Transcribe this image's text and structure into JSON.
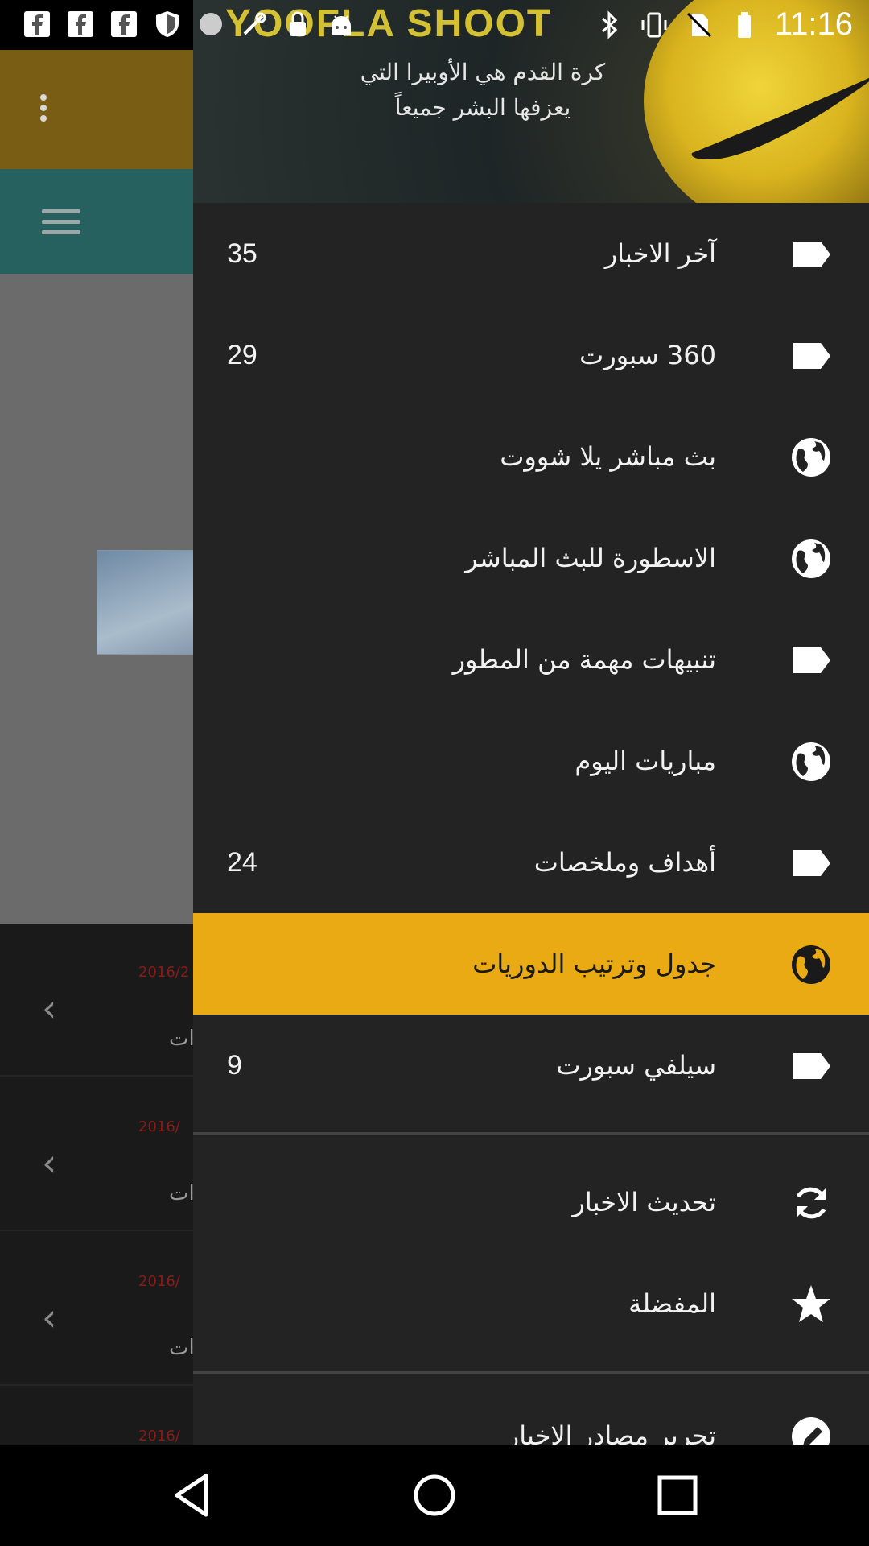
{
  "status_bar": {
    "time": "11:16",
    "left_icons": [
      "facebook-icon",
      "facebook-icon",
      "facebook-icon",
      "shield-icon",
      "circle-icon",
      "fake-gps-icon",
      "lock-icon",
      "android-icon"
    ],
    "right_icons": [
      "bluetooth-icon",
      "vibrate-icon",
      "no-sim-icon",
      "battery-icon"
    ]
  },
  "drawer": {
    "header": {
      "brand_text": "YOOFLA SHOOT",
      "quote_line_1": "كرة القدم هي الأوبيرا التي",
      "quote_line_2": "يعزفها البشر جميعاً"
    },
    "items": [
      {
        "label": "آخر الاخبار",
        "count": "35",
        "icon": "label-icon",
        "selected": false
      },
      {
        "label": "360 سبورت",
        "count": "29",
        "icon": "label-icon",
        "selected": false
      },
      {
        "label": "بث مباشر يلا شووت",
        "count": "",
        "icon": "globe-icon",
        "selected": false
      },
      {
        "label": "الاسطورة للبث المباشر",
        "count": "",
        "icon": "globe-icon",
        "selected": false
      },
      {
        "label": "تنبيهات مهمة من المطور",
        "count": "",
        "icon": "label-icon",
        "selected": false
      },
      {
        "label": "مباريات اليوم",
        "count": "",
        "icon": "globe-icon",
        "selected": false
      },
      {
        "label": "أهداف وملخصات",
        "count": "24",
        "icon": "label-icon",
        "selected": false
      },
      {
        "label": "جدول وترتيب الدوريات",
        "count": "",
        "icon": "globe-icon",
        "selected": true
      },
      {
        "label": "سيلفي سبورت",
        "count": "9",
        "icon": "label-icon",
        "selected": false
      }
    ],
    "actions": [
      {
        "label": "تحديث الاخبار",
        "icon": "refresh-icon"
      },
      {
        "label": "المفضلة",
        "icon": "star-icon"
      },
      {
        "label": "تحرير مصادر الاخبار",
        "icon": "edit-icon"
      }
    ]
  },
  "background": {
    "rows": [
      {
        "date": "2016/2",
        "text": "ات"
      },
      {
        "date": "2016/",
        "text": "ات"
      },
      {
        "date": "2016/",
        "text": "ات"
      },
      {
        "date": "2016/",
        "text": ""
      }
    ]
  },
  "colors": {
    "selected_item": "#e9aa14",
    "drawer_bg": "#232323",
    "toolbar_bg": "#7a5d14",
    "tabbar_bg": "#27615f"
  }
}
